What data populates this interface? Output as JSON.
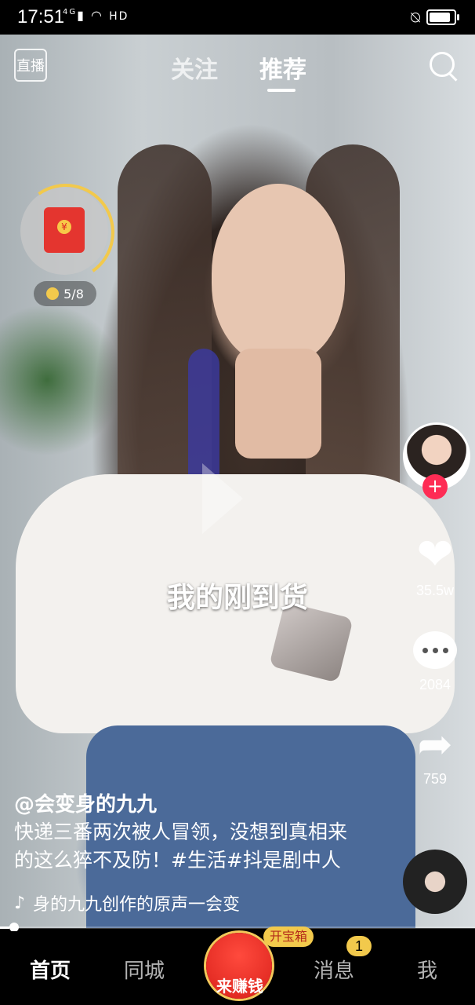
{
  "status_bar": {
    "time": "17:51",
    "network": "4G",
    "hd": "HD",
    "battery_level": 0.85
  },
  "top_nav": {
    "live_label": "直播",
    "tabs": [
      {
        "label": "关注",
        "active": false
      },
      {
        "label": "推荐",
        "active": true
      }
    ],
    "search_icon": "search-icon"
  },
  "reward_widget": {
    "coin_progress": "5/8"
  },
  "video": {
    "caption": "我的刚到货",
    "progress": 0.02
  },
  "side_actions": {
    "likes": "35.5w",
    "comments": "2084",
    "shares": "759"
  },
  "post": {
    "author": "@会变身的九九",
    "description": "快递三番两次被人冒领，没想到真相来的这么猝不及防！#生活#抖是剧中人",
    "music": "身的九九创作的原声一会变"
  },
  "bottom_nav": {
    "home": "首页",
    "city": "同城",
    "earn": "来赚钱",
    "treasure": "开宝箱",
    "messages": "消息",
    "messages_badge": "1",
    "me": "我"
  },
  "colors": {
    "accent_red": "#fe2c55",
    "badge_yellow": "#f2c94c"
  }
}
